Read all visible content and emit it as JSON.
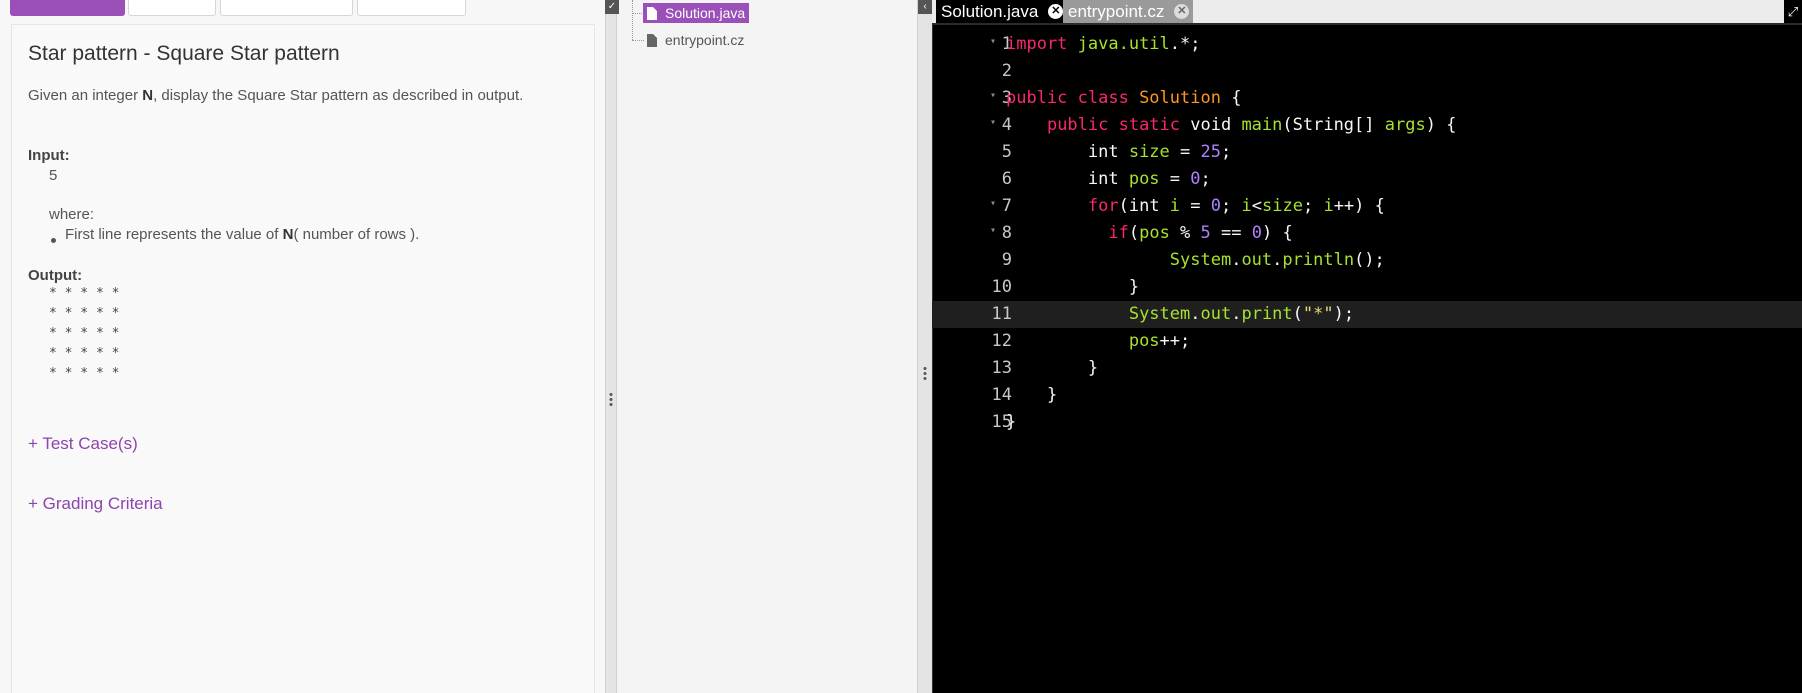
{
  "problem": {
    "title": "Star pattern - Square Star pattern",
    "description_parts": [
      "Given an integer ",
      "N",
      ", display the Square Star pattern as described in output."
    ],
    "input_label": "Input:",
    "input_value": "5",
    "where_label": "where:",
    "bullet_parts": [
      "First line represents the value of ",
      "N",
      "( number of rows )."
    ],
    "output_label": "Output:",
    "output_rows": [
      "* * * * *",
      "* * * * *",
      "* * * * *",
      "* * * * *",
      "* * * * *"
    ],
    "test_cases_link": "+ Test Case(s)",
    "grading_link": "+ Grading Criteria"
  },
  "file_tree": {
    "files": [
      {
        "name": "Solution.java",
        "selected": true
      },
      {
        "name": "entrypoint.cz",
        "selected": false
      }
    ]
  },
  "editor": {
    "tabs": [
      {
        "label": "Solution.java",
        "active": true
      },
      {
        "label": "entrypoint.cz",
        "active": false
      }
    ],
    "close_glyph": "✕",
    "expand_glyph": "⤢",
    "active_line": 11,
    "lines": [
      {
        "n": "1",
        "fold": true,
        "tokens": [
          [
            "kw",
            "import "
          ],
          [
            "var",
            "java.util"
          ],
          [
            "ty",
            ".*;"
          ]
        ]
      },
      {
        "n": "2",
        "fold": false,
        "tokens": []
      },
      {
        "n": "3",
        "fold": true,
        "tokens": [
          [
            "kw",
            "public class "
          ],
          [
            "cls",
            "Solution"
          ],
          [
            "ty",
            " {"
          ]
        ]
      },
      {
        "n": "4",
        "fold": true,
        "tokens": [
          [
            "ty",
            "    "
          ],
          [
            "kw",
            "public static "
          ],
          [
            "ty",
            "void "
          ],
          [
            "var",
            "main"
          ],
          [
            "ty",
            "(String[] "
          ],
          [
            "var",
            "args"
          ],
          [
            "ty",
            ") {"
          ]
        ]
      },
      {
        "n": "5",
        "fold": false,
        "tokens": [
          [
            "ty",
            "        int "
          ],
          [
            "var",
            "size"
          ],
          [
            "ty",
            " = "
          ],
          [
            "num",
            "25"
          ],
          [
            "ty",
            ";"
          ]
        ]
      },
      {
        "n": "6",
        "fold": false,
        "tokens": [
          [
            "ty",
            "        int "
          ],
          [
            "var",
            "pos"
          ],
          [
            "ty",
            " = "
          ],
          [
            "num",
            "0"
          ],
          [
            "ty",
            ";"
          ]
        ]
      },
      {
        "n": "7",
        "fold": true,
        "tokens": [
          [
            "ty",
            "        "
          ],
          [
            "kw",
            "for"
          ],
          [
            "ty",
            "(int "
          ],
          [
            "var",
            "i"
          ],
          [
            "ty",
            " = "
          ],
          [
            "num",
            "0"
          ],
          [
            "ty",
            "; "
          ],
          [
            "var",
            "i"
          ],
          [
            "ty",
            "<"
          ],
          [
            "var",
            "size"
          ],
          [
            "ty",
            "; "
          ],
          [
            "var",
            "i"
          ],
          [
            "ty",
            "++) {"
          ]
        ]
      },
      {
        "n": "8",
        "fold": true,
        "tokens": [
          [
            "ty",
            "          "
          ],
          [
            "kw",
            "if"
          ],
          [
            "ty",
            "("
          ],
          [
            "var",
            "pos"
          ],
          [
            "ty",
            " % "
          ],
          [
            "num",
            "5"
          ],
          [
            "ty",
            " == "
          ],
          [
            "num",
            "0"
          ],
          [
            "ty",
            ") {"
          ]
        ]
      },
      {
        "n": "9",
        "fold": false,
        "tokens": [
          [
            "ty",
            "                "
          ],
          [
            "var",
            "System"
          ],
          [
            "ty",
            "."
          ],
          [
            "var",
            "out"
          ],
          [
            "ty",
            "."
          ],
          [
            "var",
            "println"
          ],
          [
            "ty",
            "();"
          ]
        ]
      },
      {
        "n": "10",
        "fold": false,
        "tokens": [
          [
            "ty",
            "            }"
          ]
        ]
      },
      {
        "n": "11",
        "fold": false,
        "tokens": [
          [
            "ty",
            "            "
          ],
          [
            "var",
            "System"
          ],
          [
            "ty",
            "."
          ],
          [
            "var",
            "out"
          ],
          [
            "ty",
            "."
          ],
          [
            "var",
            "print"
          ],
          [
            "ty",
            "("
          ],
          [
            "str",
            "\"*\""
          ],
          [
            "ty",
            ");"
          ]
        ]
      },
      {
        "n": "12",
        "fold": false,
        "tokens": [
          [
            "ty",
            "            "
          ],
          [
            "var",
            "pos"
          ],
          [
            "ty",
            "++;"
          ]
        ]
      },
      {
        "n": "13",
        "fold": false,
        "tokens": [
          [
            "ty",
            "        }"
          ]
        ]
      },
      {
        "n": "14",
        "fold": false,
        "tokens": [
          [
            "ty",
            "    }"
          ]
        ]
      },
      {
        "n": "15",
        "fold": false,
        "tokens": [
          [
            "ty",
            "}"
          ]
        ]
      }
    ]
  }
}
